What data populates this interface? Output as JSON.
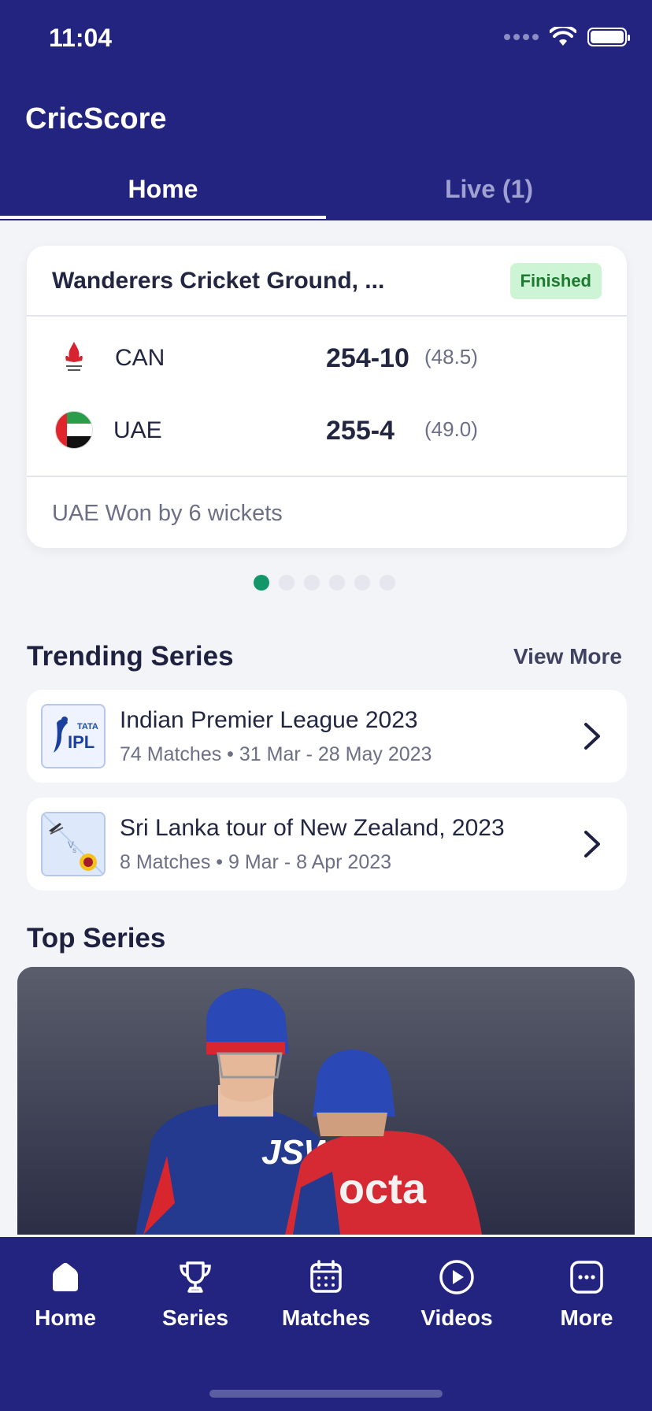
{
  "status_bar": {
    "time": "11:04"
  },
  "app": {
    "title": "CricScore"
  },
  "tabs": [
    {
      "label": "Home",
      "active": true
    },
    {
      "label": "Live (1)",
      "active": false
    }
  ],
  "match": {
    "venue": "Wanderers Cricket Ground, ...",
    "status": "Finished",
    "teams": [
      {
        "name": "CAN",
        "score": "254-10",
        "overs": "(48.5)",
        "logo": "canada-cricket-logo"
      },
      {
        "name": "UAE",
        "score": "255-4",
        "overs": "(49.0)",
        "logo": "uae-flag"
      }
    ],
    "result": "UAE Won by 6 wickets",
    "pager": {
      "count": 6,
      "active_index": 0
    }
  },
  "trending": {
    "title": "Trending Series",
    "view_more": "View More",
    "items": [
      {
        "name": "Indian Premier League 2023",
        "meta": "74 Matches • 31 Mar - 28 May 2023",
        "logo": "ipl-logo"
      },
      {
        "name": "Sri Lanka tour of New Zealand, 2023",
        "meta": "8 Matches • 9 Mar - 8 Apr 2023",
        "logo": "nz-vs-sl-logo"
      }
    ]
  },
  "top_series": {
    "title": "Top Series",
    "image": "cricket-players-photo"
  },
  "bottom_nav": [
    {
      "label": "Home",
      "icon": "home-icon"
    },
    {
      "label": "Series",
      "icon": "trophy-icon"
    },
    {
      "label": "Matches",
      "icon": "calendar-icon"
    },
    {
      "label": "Videos",
      "icon": "play-circle-icon"
    },
    {
      "label": "More",
      "icon": "more-dots-icon"
    }
  ],
  "colors": {
    "primary": "#23247f",
    "accent": "#12966a",
    "badge_bg": "#cdf5d5",
    "badge_text": "#1e7a31"
  }
}
